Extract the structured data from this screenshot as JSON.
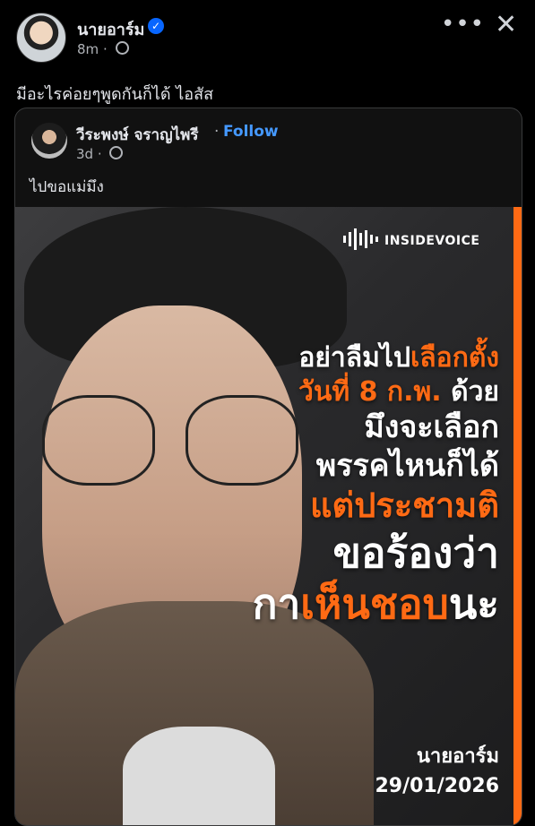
{
  "post": {
    "author": "นายอาร์ม",
    "time": "8m",
    "caption": "มีอะไรค่อยๆพูดกันก็ได้ ไอสัส",
    "more_icon": "more-horizontal-icon",
    "close_icon": "close-icon",
    "verified_icon": "verified-badge-icon",
    "privacy_icon": "globe-icon"
  },
  "shared": {
    "author": "วีระพงษ์ จราญไพรี",
    "separator": "·",
    "follow_label": "Follow",
    "time": "3d",
    "caption": "ไปขอแม่มึง"
  },
  "image": {
    "brand": "INSIDEVOICE",
    "line1_a": "อย่าลืมไป",
    "line1_b": "เลือกตั้ง",
    "line2_a": "วันที่ 8 ก.พ.",
    "line2_b": " ด้วย",
    "line3": "มึงจะเลือก",
    "line4": "พรรคไหนก็ได้",
    "line5": "แต่ประชามติ",
    "line6": "ขอร้องว่า",
    "line7_a": "กา",
    "line7_b": "เห็นชอบ",
    "line7_c": "นะ",
    "signature": "นายอาร์ม",
    "date": "29/01/2026",
    "accent": "#ff6a14"
  },
  "colors": {
    "background": "#000000",
    "text": "#e4e6eb",
    "muted": "#b0b3b8",
    "link": "#4599ff",
    "verified": "#0866ff"
  }
}
